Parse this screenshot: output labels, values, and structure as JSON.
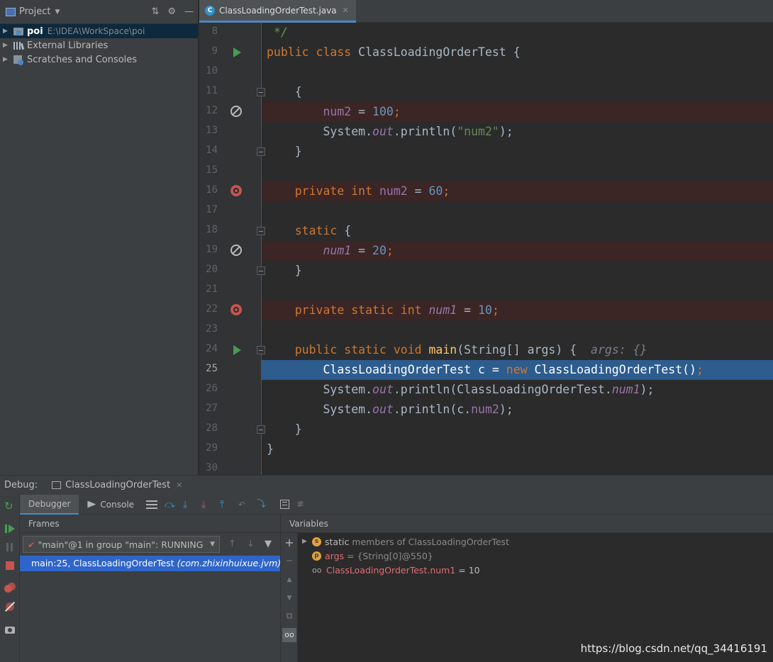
{
  "project": {
    "header_title": "Project",
    "tree": [
      {
        "name": "poi",
        "path": "E:\\IDEA\\WorkSpace\\poi"
      },
      {
        "name": "External Libraries"
      },
      {
        "name": "Scratches and Consoles"
      }
    ]
  },
  "editor": {
    "tab_title": "ClassLoadingOrderTest.java",
    "line_numbers": [
      "8",
      "9",
      "10",
      "11",
      "12",
      "13",
      "14",
      "15",
      "16",
      "17",
      "18",
      "19",
      "20",
      "21",
      "22",
      "23",
      "24",
      "25",
      "26",
      "27",
      "28",
      "29",
      "30"
    ],
    "lines": {
      "l8_comment": " */",
      "l9_kw": "public class",
      "l9_name": "ClassLoadingOrderTest",
      "l9_brace": " {",
      "l11": "{",
      "l12_field": "num2",
      "l12_eq": " = ",
      "l12_num": "100",
      "l12_semi": ";",
      "l13_sys": "System.",
      "l13_out": "out",
      "l13_call": ".println(",
      "l13_str": "\"num2\"",
      "l13_end": ");",
      "l14": "}",
      "l16_kw": "private int",
      "l16_field": "num2",
      "l16_eq": " = ",
      "l16_num": "60",
      "l16_semi": ";",
      "l18_kw": "static",
      "l18_brace": " {",
      "l19_field": "num1",
      "l19_eq": " = ",
      "l19_num": "20",
      "l19_semi": ";",
      "l20": "}",
      "l22_kw": "private static int",
      "l22_field": "num1",
      "l22_eq": " = ",
      "l22_num": "10",
      "l22_semi": ";",
      "l24_kw": "public static void",
      "l24_method": "main",
      "l24_params": "(String[] args) {",
      "l24_hint": "args: {}",
      "l25_a": "ClassLoadingOrderTest c = ",
      "l25_new": "new",
      "l25_b": " ClassLoadingOrderTest()",
      "l25_semi": ";",
      "l26_sys": "System.",
      "l26_out": "out",
      "l26_call": ".println(ClassLoadingOrderTest.",
      "l26_field": "num1",
      "l26_end": ");",
      "l27_sys": "System.",
      "l27_out": "out",
      "l27_call": ".println(c.",
      "l27_field": "num2",
      "l27_end": ");",
      "l28": "}",
      "l29": "}"
    }
  },
  "debug": {
    "label": "Debug:",
    "session_tab": "ClassLoadingOrderTest",
    "tabs": [
      "Debugger",
      "Console"
    ],
    "frames_header": "Frames",
    "thread_select": "\"main\"@1 in group \"main\": RUNNING",
    "frame": {
      "location": "main:25, ClassLoadingOrderTest",
      "package": "(com.zhixinhuixue.jvm)"
    },
    "variables_header": "Variables",
    "variables": {
      "static_label": "static",
      "static_desc": "members of ClassLoadingOrderTest",
      "args_name": "args",
      "args_value": "= {String[0]@550}",
      "watch_name": "ClassLoadingOrderTest.num1",
      "watch_value": "= 10"
    }
  },
  "watermark": "https://blog.csdn.net/qq_34416191",
  "colors": {
    "accent": "#4a88c7",
    "selection": "#2f65ca",
    "breakpoint": "#c75450",
    "run": "#499c54"
  }
}
